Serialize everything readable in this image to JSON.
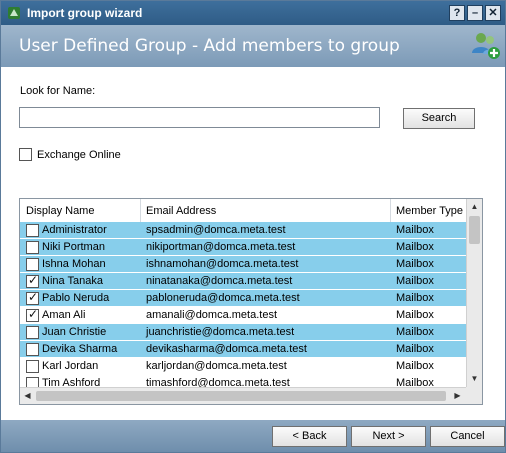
{
  "window": {
    "title": "Import group wizard"
  },
  "titlebar_buttons": {
    "help": "?",
    "minimize": "–",
    "close": "✕"
  },
  "header": {
    "title": "User Defined Group - Add members to group"
  },
  "search": {
    "label": "Look for Name:",
    "value": "",
    "button": "Search"
  },
  "exchange_online": {
    "label": "Exchange Online",
    "checked": false
  },
  "grid": {
    "columns": [
      "Display Name",
      "Email Address",
      "Member Type"
    ],
    "rows": [
      {
        "name": "Administrator",
        "email": "spsadmin@domca.meta.test",
        "type": "Mailbox",
        "checked": false,
        "selected": true
      },
      {
        "name": "Niki Portman",
        "email": "nikiportman@domca.meta.test",
        "type": "Mailbox",
        "checked": false,
        "selected": true
      },
      {
        "name": "Ishna Mohan",
        "email": "ishnamohan@domca.meta.test",
        "type": "Mailbox",
        "checked": false,
        "selected": true
      },
      {
        "name": "Nina Tanaka",
        "email": "ninatanaka@domca.meta.test",
        "type": "Mailbox",
        "checked": true,
        "selected": true
      },
      {
        "name": "Pablo Neruda",
        "email": "pabloneruda@domca.meta.test",
        "type": "Mailbox",
        "checked": true,
        "selected": true
      },
      {
        "name": "Aman Ali",
        "email": "amanali@domca.meta.test",
        "type": "Mailbox",
        "checked": true,
        "selected": false
      },
      {
        "name": "Juan Christie",
        "email": "juanchristie@domca.meta.test",
        "type": "Mailbox",
        "checked": false,
        "selected": true
      },
      {
        "name": "Devika Sharma",
        "email": "devikasharma@domca.meta.test",
        "type": "Mailbox",
        "checked": false,
        "selected": true
      },
      {
        "name": "Karl Jordan",
        "email": "karljordan@domca.meta.test",
        "type": "Mailbox",
        "checked": false,
        "selected": false
      },
      {
        "name": "Tim Ashford",
        "email": "timashford@domca.meta.test",
        "type": "Mailbox",
        "checked": false,
        "selected": false
      }
    ]
  },
  "footer": {
    "back": "< Back",
    "next": "Next >",
    "cancel": "Cancel"
  },
  "colors": {
    "selected_row": "#87ceeb",
    "titlebar": "#2f5c86",
    "header_band": "#8aa6c1"
  },
  "icons": {
    "app": "wizard-app-icon",
    "header": "users-add-icon"
  }
}
